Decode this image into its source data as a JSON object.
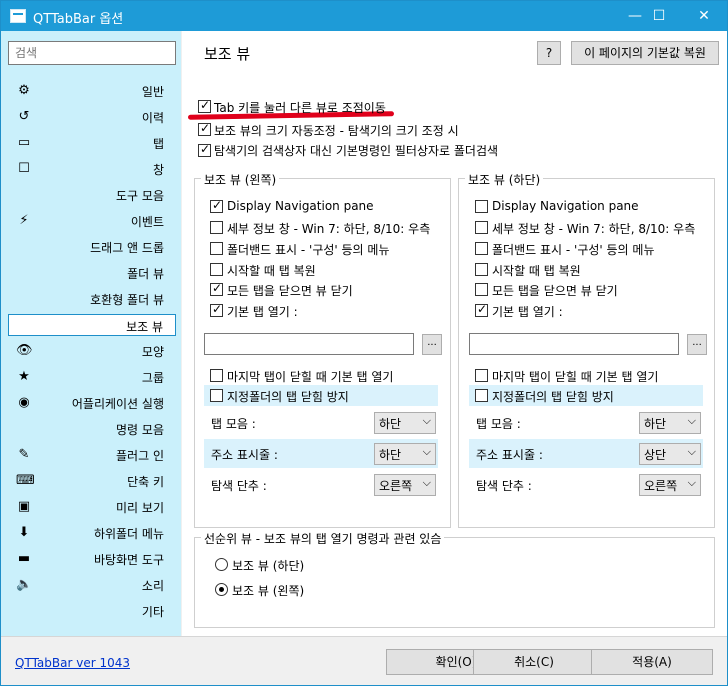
{
  "window": {
    "title": "QTTabBar 옵션",
    "minimize": "—",
    "maximize": "☐",
    "close": "✕"
  },
  "sidebar": {
    "search_placeholder": "검색",
    "items": [
      {
        "label": "일반",
        "icon": "⚙"
      },
      {
        "label": "이력",
        "icon": "↺"
      },
      {
        "label": "탭",
        "icon": "▭"
      },
      {
        "label": "창",
        "icon": "☐"
      },
      {
        "label": "도구 모음",
        "icon": ""
      },
      {
        "label": "이벤트",
        "icon": "⚡"
      },
      {
        "label": "드래그 앤 드롭",
        "icon": ""
      },
      {
        "label": "폴더 뷰",
        "icon": ""
      },
      {
        "label": "호환형 폴더 뷰",
        "icon": ""
      },
      {
        "label": "보조 뷰",
        "icon": ""
      },
      {
        "label": "모양",
        "icon": "👁"
      },
      {
        "label": "그룹",
        "icon": "★"
      },
      {
        "label": "어플리케이션 실행",
        "icon": "◉"
      },
      {
        "label": "명령 모음",
        "icon": ""
      },
      {
        "label": "플러그 인",
        "icon": "✎"
      },
      {
        "label": "단축 키",
        "icon": "⌨"
      },
      {
        "label": "미리 보기",
        "icon": "▣"
      },
      {
        "label": "하위폴더 메뉴",
        "icon": "⬇"
      },
      {
        "label": "바탕화면 도구",
        "icon": "▬"
      },
      {
        "label": "소리",
        "icon": "🔈"
      },
      {
        "label": "기타",
        "icon": ""
      }
    ]
  },
  "main": {
    "title": "보조 뷰",
    "help_label": "?",
    "reset_label": "이 페이지의 기본값 복원",
    "top_options": [
      {
        "label": "Tab 키를 눌러 다른 뷰로 조점이동",
        "checked": true
      },
      {
        "label": "보조 뷰의 크기 자동조정 - 탐색기의 크기 조정 시",
        "checked": true
      },
      {
        "label": "탐색기의 검색상자 대신 기본명령인 필터상자로 폴더검색",
        "checked": true
      }
    ],
    "left_group": {
      "legend": "보조 뷰 (왼쪽)",
      "options": [
        {
          "label": "Display Navigation pane",
          "checked": true
        },
        {
          "label": "세부 정보 창 - Win 7: 하단, 8/10: 우측",
          "checked": false
        },
        {
          "label": "폴더밴드 표시 - '구성' 등의 메뉴",
          "checked": false
        },
        {
          "label": "시작할 때 탭 복원",
          "checked": false
        },
        {
          "label": "모든 탭을 닫으면 뷰 닫기",
          "checked": true
        },
        {
          "label": "기본 탭 열기 :",
          "checked": true
        }
      ],
      "path_value": "",
      "browse_label": "...",
      "options2": [
        {
          "label": "마지막 탭이 닫힐 때 기본 탭 열기",
          "checked": false
        },
        {
          "label": "지정폴더의 탭 닫힘 방지",
          "checked": false
        }
      ],
      "selects": [
        {
          "label": "탭 모음 :",
          "value": "하단"
        },
        {
          "label": "주소 표시줄 :",
          "value": "하단"
        },
        {
          "label": "탐색 단추 :",
          "value": "오른쪽"
        }
      ]
    },
    "right_group": {
      "legend": "보조 뷰 (하단)",
      "options": [
        {
          "label": "Display Navigation pane",
          "checked": false
        },
        {
          "label": "세부 정보 창 - Win 7: 하단, 8/10: 우측",
          "checked": false
        },
        {
          "label": "폴더밴드 표시 - '구성' 등의 메뉴",
          "checked": false
        },
        {
          "label": "시작할 때 탭 복원",
          "checked": false
        },
        {
          "label": "모든 탭을 닫으면 뷰 닫기",
          "checked": false
        },
        {
          "label": "기본 탭 열기 :",
          "checked": true
        }
      ],
      "path_value": "",
      "browse_label": "...",
      "options2": [
        {
          "label": "마지막 탭이 닫힐 때 기본 탭 열기",
          "checked": false
        },
        {
          "label": "지정폴더의 탭 닫힘 방지",
          "checked": false
        }
      ],
      "selects": [
        {
          "label": "탭 모음 :",
          "value": "하단"
        },
        {
          "label": "주소 표시줄 :",
          "value": "상단"
        },
        {
          "label": "탐색 단추 :",
          "value": "오른쪽"
        }
      ]
    },
    "priority_group": {
      "legend": "선순위 뷰 - 보조 뷰의 탭 열기 명령과 관련 있슴",
      "radios": [
        {
          "label": "보조 뷰 (하단)",
          "checked": false
        },
        {
          "label": "보조 뷰 (왼쪽)",
          "checked": true
        }
      ]
    }
  },
  "footer": {
    "version": "QTTabBar ver 1043",
    "ok": "확인(O)",
    "cancel": "취소(C)",
    "apply": "적용(A)"
  },
  "colors": {
    "titlebar": "#1e9bd7",
    "sidebar": "#caf0fb",
    "highlight": "#daf2fc",
    "annotation_line": "#e0001b"
  }
}
